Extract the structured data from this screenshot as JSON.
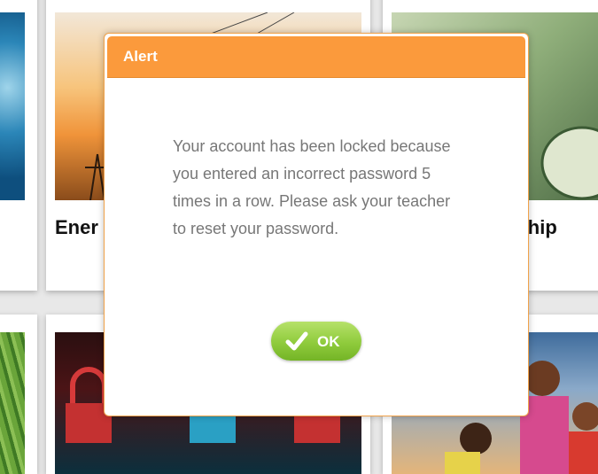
{
  "cards": {
    "energy_title_fragment": "Ener",
    "scholarship_title_fragment": "rship"
  },
  "dialog": {
    "title": "Alert",
    "message": "Your account has been locked because you entered an incorrect password 5 times in a row. Please ask your teacher to reset your password.",
    "ok_label": "OK"
  },
  "colors": {
    "header_orange": "#fb9a3c",
    "ok_green": "#8fcb3c",
    "message_gray": "#777777"
  },
  "icons": {
    "ok": "check-icon"
  }
}
